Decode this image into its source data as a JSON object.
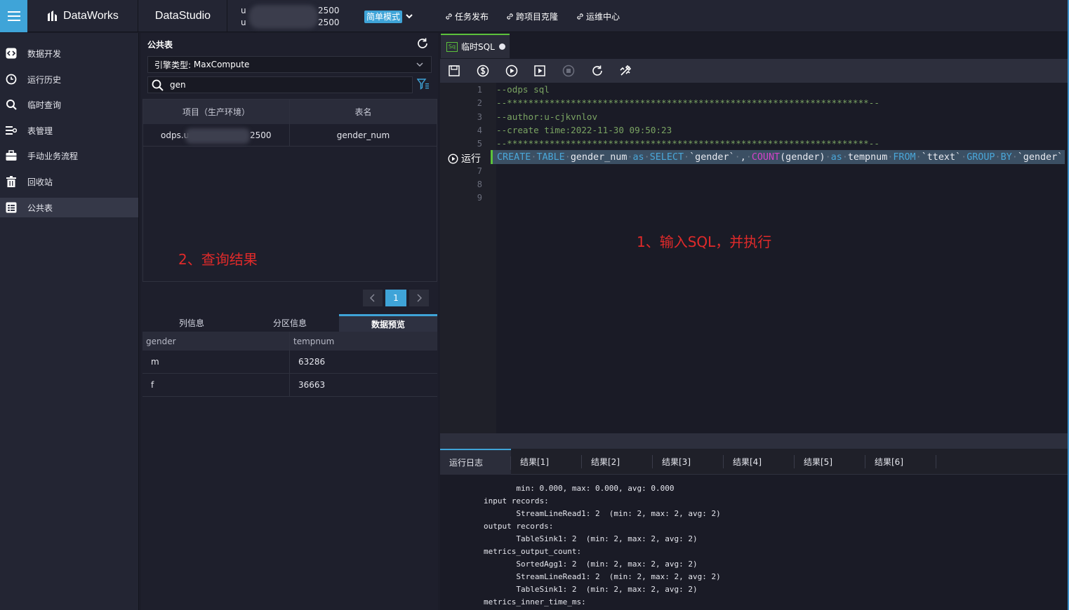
{
  "topbar": {
    "brand": "DataWorks",
    "studio": "DataStudio",
    "project_line1_prefix": "u",
    "project_line1_suffix": "2500",
    "project_line2_prefix": "u",
    "project_line2_suffix": "2500",
    "mode_label": "简单模式",
    "links": [
      "任务发布",
      "跨项目克隆",
      "运维中心"
    ]
  },
  "nav": {
    "items": [
      {
        "label": "数据开发",
        "icon": "code-icon"
      },
      {
        "label": "运行历史",
        "icon": "clock-icon"
      },
      {
        "label": "临时查询",
        "icon": "search-icon"
      },
      {
        "label": "表管理",
        "icon": "table-manage-icon"
      },
      {
        "label": "手动业务流程",
        "icon": "briefcase-icon"
      },
      {
        "label": "回收站",
        "icon": "trash-icon"
      },
      {
        "label": "公共表",
        "icon": "public-table-icon"
      }
    ],
    "active_index": 6
  },
  "table_panel": {
    "title": "公共表",
    "engine_label": "引擎类型:",
    "engine_value": "MaxCompute",
    "search_value": "gen",
    "columns": [
      "项目（生产环境）",
      "表名"
    ],
    "rows": [
      {
        "project_prefix": "odps.u",
        "project_suffix": "2500",
        "table": "gender_num"
      }
    ],
    "page": "1",
    "subtabs": [
      "列信息",
      "分区信息",
      "数据预览"
    ],
    "active_subtab": 2,
    "preview": {
      "columns": [
        "gender",
        "tempnum"
      ],
      "rows": [
        [
          "m",
          "63286"
        ],
        [
          "f",
          "36663"
        ]
      ]
    },
    "annotation": "2、查询结果"
  },
  "editor": {
    "tab_label": "临时SQL",
    "tab_icon_text": "Sq",
    "run_label": "运行",
    "line_numbers": [
      "1",
      "2",
      "3",
      "4",
      "5",
      "",
      "7",
      "8",
      "9"
    ],
    "lines": {
      "l1": "--odps sql",
      "l2": "--********************************************************************--",
      "l3": "--author:u-cjkvnlov",
      "l4": "--create time:2022-11-30 09:50:23",
      "l5": "--********************************************************************--"
    },
    "sql": {
      "k1": "CREATE",
      "k2": "TABLE",
      "t1": "gender_num",
      "k3": "as",
      "k4": "SELECT",
      "t2": "`gender`",
      "t3": ",",
      "f1": "COUNT",
      "t4": "(gender)",
      "k5": "as",
      "t5": "tempnum",
      "k6": "FROM",
      "t6": "`ttext`",
      "k7": "GROUP",
      "k8": "BY",
      "t7": "`gender`"
    },
    "annotation": "1、输入SQL，并执行"
  },
  "results": {
    "tabs": [
      "运行日志",
      "结果[1]",
      "结果[2]",
      "结果[3]",
      "结果[4]",
      "结果[5]",
      "结果[6]"
    ],
    "active_tab": 0,
    "log_lines": [
      "       min: 0.000, max: 0.000, avg: 0.000",
      "input records:",
      "       StreamLineRead1: 2  (min: 2, max: 2, avg: 2)",
      "output records:",
      "       TableSink1: 2  (min: 2, max: 2, avg: 2)",
      "metrics_output_count:",
      "       SortedAgg1: 2  (min: 2, max: 2, avg: 2)",
      "       StreamLineRead1: 2  (min: 2, max: 2, avg: 2)",
      "       TableSink1: 2  (min: 2, max: 2, avg: 2)",
      "metrics_inner_time_ms:"
    ]
  },
  "colors": {
    "accent": "#3fa4d8",
    "success": "#5cc23b",
    "annotation": "#e02a2a"
  }
}
